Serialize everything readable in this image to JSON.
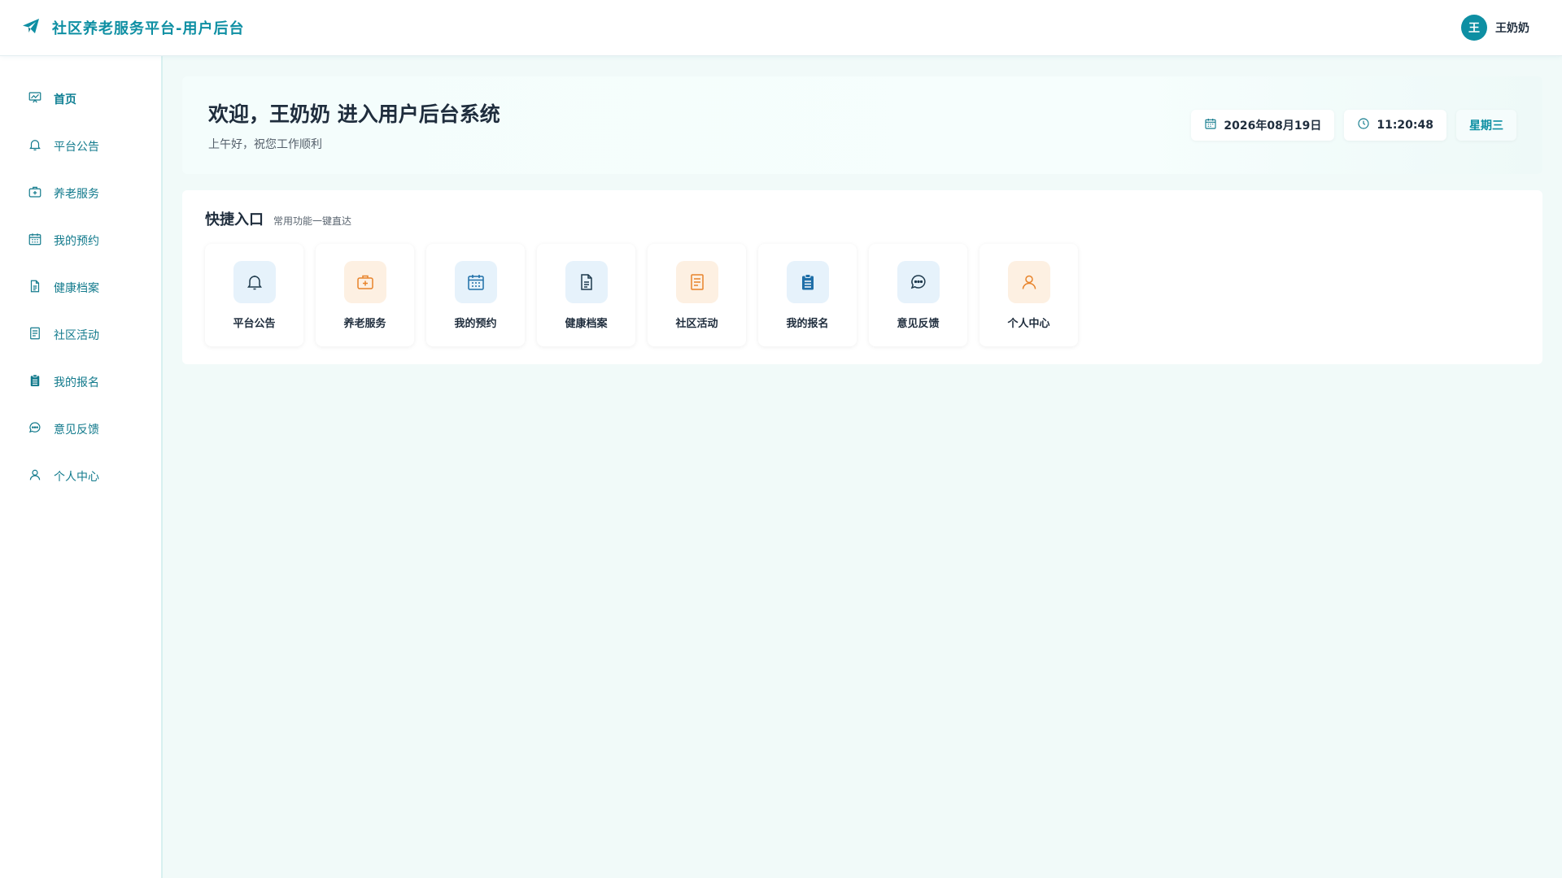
{
  "app": {
    "title": "社区养老服务平台-用户后台"
  },
  "user": {
    "avatar_text": "王",
    "name": "王奶奶"
  },
  "sidebar": {
    "items": [
      {
        "label": "首页",
        "icon": "home-chart-icon"
      },
      {
        "label": "平台公告",
        "icon": "bell-icon"
      },
      {
        "label": "养老服务",
        "icon": "medical-kit-icon"
      },
      {
        "label": "我的预约",
        "icon": "calendar-icon"
      },
      {
        "label": "健康档案",
        "icon": "document-icon"
      },
      {
        "label": "社区活动",
        "icon": "list-document-icon"
      },
      {
        "label": "我的报名",
        "icon": "clipboard-icon"
      },
      {
        "label": "意见反馈",
        "icon": "chat-icon"
      },
      {
        "label": "个人中心",
        "icon": "user-icon"
      }
    ]
  },
  "welcome": {
    "title": "欢迎，王奶奶 进入用户后台系统",
    "subtitle": "上午好，祝您工作顺利",
    "date": "2026年08月19日",
    "time": "11:20:48",
    "weekday": "星期三"
  },
  "quick": {
    "title": "快捷入口",
    "subtitle": "常用功能一键直达",
    "tiles": [
      {
        "label": "平台公告",
        "icon": "bell-icon",
        "color": "#e6f2fb"
      },
      {
        "label": "养老服务",
        "icon": "medical-kit-icon",
        "color": "#fdf0e2"
      },
      {
        "label": "我的预约",
        "icon": "calendar-icon",
        "color": "#e6f2fb"
      },
      {
        "label": "健康档案",
        "icon": "document-icon",
        "color": "#e6f2fb"
      },
      {
        "label": "社区活动",
        "icon": "list-document-icon",
        "color": "#fdf0e2"
      },
      {
        "label": "我的报名",
        "icon": "clipboard-icon",
        "color": "#e6f2fb"
      },
      {
        "label": "意见反馈",
        "icon": "chat-icon",
        "color": "#e6f2fb"
      },
      {
        "label": "个人中心",
        "icon": "user-icon",
        "color": "#fdf0e2"
      }
    ]
  },
  "colors": {
    "accent": "#0e8fa3",
    "background": "#f1faf9",
    "orange": "#e8832a",
    "blue": "#1f6fa8"
  }
}
